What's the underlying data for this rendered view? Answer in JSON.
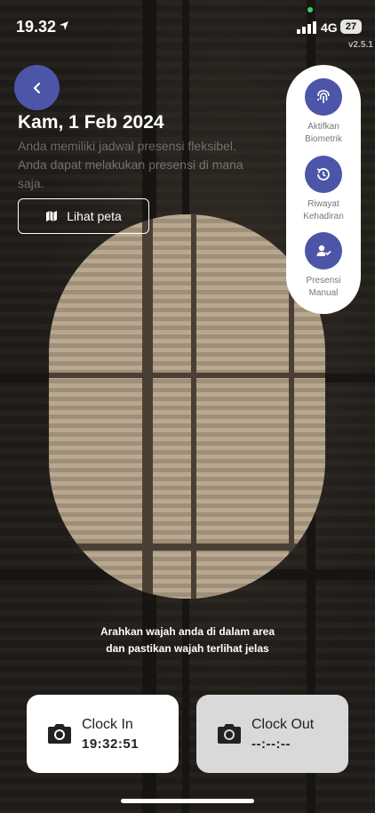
{
  "status_bar": {
    "time": "19.32",
    "network": "4G",
    "battery": "27"
  },
  "app": {
    "version": "v2.5.1"
  },
  "header": {
    "date": "Kam, 1 Feb 2024",
    "info_text": "Anda memiliki jadwal presensi fleksibel. Anda dapat melakukan presensi di mana saja.",
    "map_button": "Lihat peta"
  },
  "menu": {
    "items": [
      {
        "label_1": "Aktifkan",
        "label_2": "Biometrik",
        "icon": "fingerprint-icon"
      },
      {
        "label_1": "Riwayat",
        "label_2": "Kehadiran",
        "icon": "history-icon"
      },
      {
        "label_1": "Presensi",
        "label_2": "Manual",
        "icon": "user-check-icon"
      }
    ]
  },
  "guide": {
    "line_1": "Arahkan wajah anda di dalam area",
    "line_2": "dan pastikan wajah terlihat jelas"
  },
  "clock_in": {
    "label": "Clock In",
    "value": "19:32:51"
  },
  "clock_out": {
    "label": "Clock Out",
    "value": "--:--:--"
  },
  "colors": {
    "accent": "#4c55a8"
  }
}
